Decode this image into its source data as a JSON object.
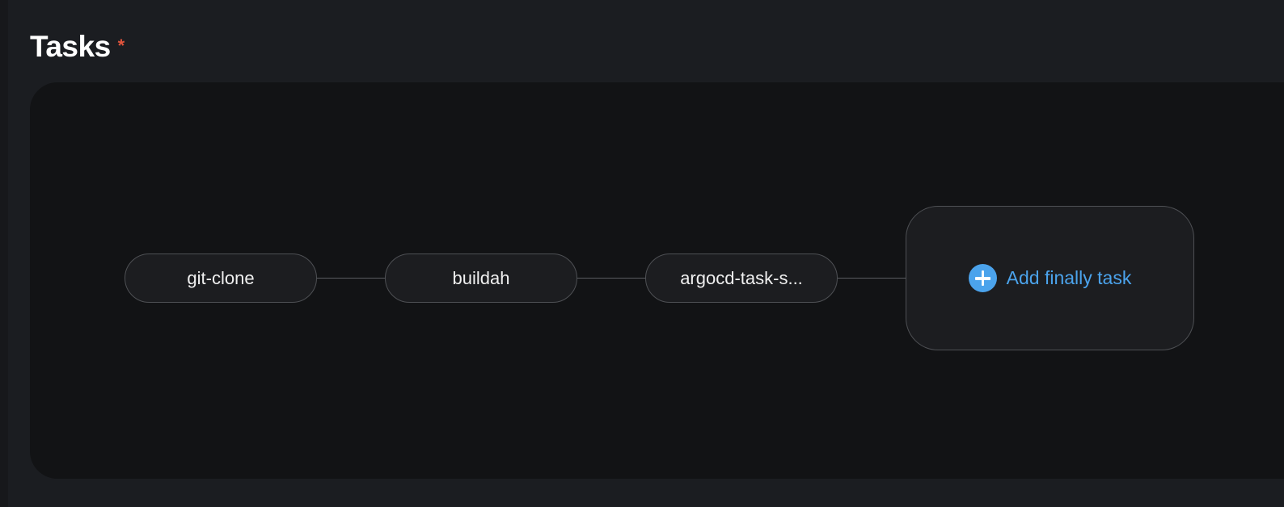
{
  "section": {
    "title": "Tasks",
    "required_marker": "*"
  },
  "pipeline": {
    "tasks": [
      {
        "label": "git-clone"
      },
      {
        "label": "buildah"
      },
      {
        "label": "argocd-task-s..."
      }
    ],
    "finally": {
      "label": "Add finally task",
      "icon": "plus-circle-icon"
    }
  },
  "colors": {
    "background": "#1b1d21",
    "canvas": "#121315",
    "node_border": "#4e5054",
    "accent": "#4ba3ec",
    "required": "#e0543c"
  }
}
